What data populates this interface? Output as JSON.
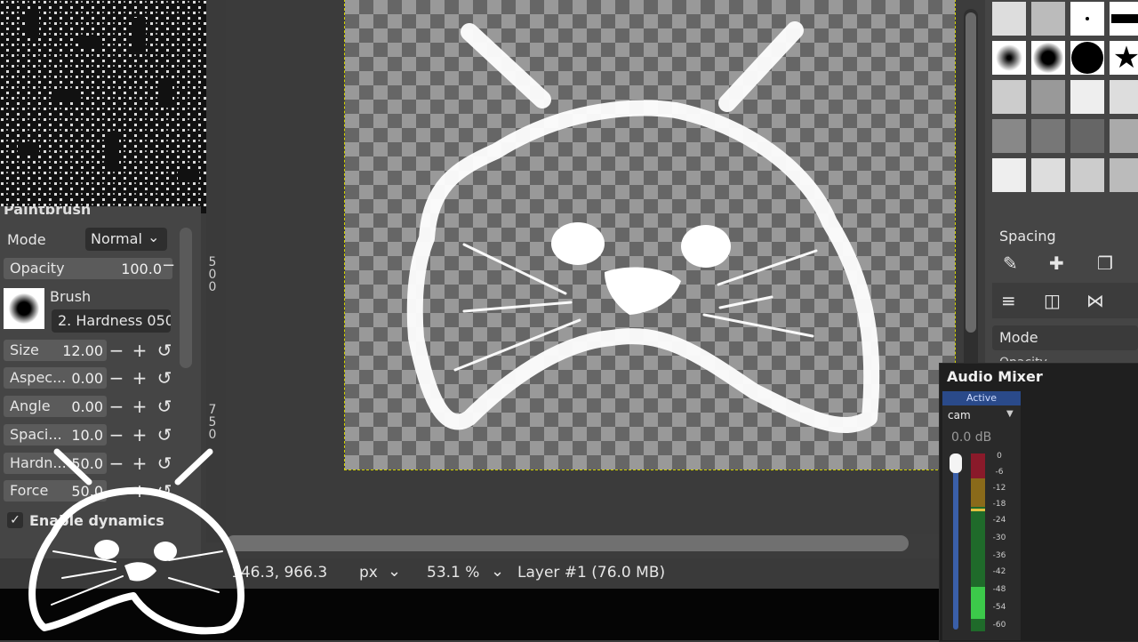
{
  "tool_options": {
    "title": "Paintbrush",
    "mode_label": "Mode",
    "mode_value": "Normal",
    "opacity_label": "Opacity",
    "opacity_value": "100.0",
    "brush_label": "Brush",
    "brush_name": "2. Hardness 050",
    "size_label": "Size",
    "size_value": "12.00",
    "aspect_label": "Aspec...",
    "aspect_value": "0.00",
    "angle_label": "Angle",
    "angle_value": "0.00",
    "spacing_label": "Spaci...",
    "spacing_value": "10.0",
    "hardness_label": "Hardn...",
    "hardness_value": "50.0",
    "force_label": "Force",
    "force_value": "50.0",
    "dynamics_label": "Enable dynamics",
    "dynamics_checked": true
  },
  "ruler": {
    "marks_1": [
      "5",
      "0",
      "0"
    ],
    "marks_2": [
      "7",
      "5",
      "0"
    ]
  },
  "statusbar": {
    "coords": "146.3, 966.3",
    "unit": "px",
    "zoom": "53.1 %",
    "layer": "Layer #1 (76.0 MB)"
  },
  "right_panel": {
    "spacing_label": "Spacing",
    "mode_label": "Mode",
    "opacity_partial": "Opacity"
  },
  "audio_mixer": {
    "title": "Audio Mixer",
    "status": "Active",
    "source": "cam",
    "level": "0.0 dB",
    "scale": [
      "0",
      "-6",
      "-12",
      "-18",
      "-24",
      "-30",
      "-36",
      "-42",
      "-48",
      "-54",
      "-60"
    ]
  },
  "colors": {
    "panel": "#454545",
    "canvas_border": "#d4d400",
    "mixer_bg": "#1f1f1f",
    "meter_green": "#3cc94a",
    "meter_red": "#8a1a2a"
  }
}
